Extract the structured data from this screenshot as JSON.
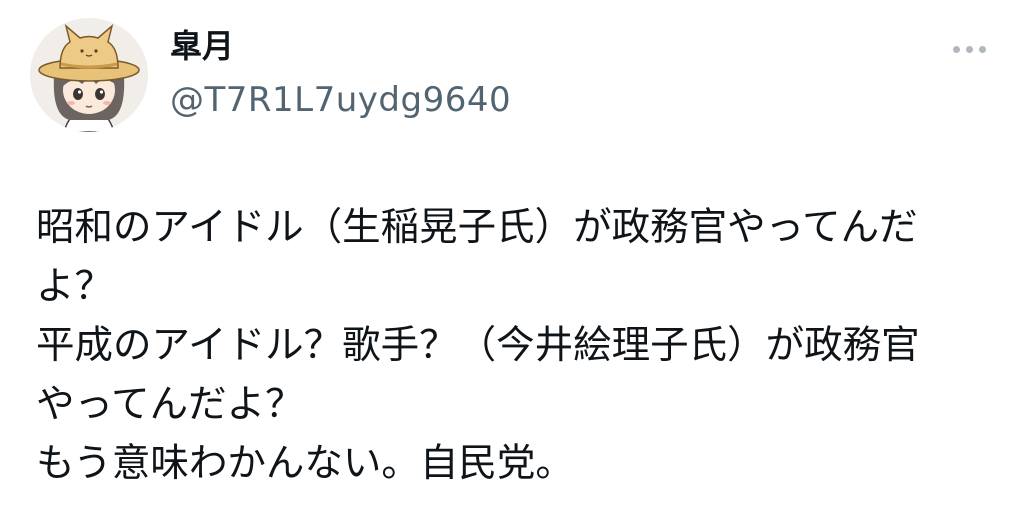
{
  "user": {
    "display_name": "皐月",
    "handle": "@T7R1L7uydg9640",
    "avatar_icon": "cat-ear-straw-hat-girl-avatar"
  },
  "actions": {
    "more_icon": "more-horizontal-icon"
  },
  "tweet": {
    "lines": [
      "昭和のアイドル（生稲晃子氏）が政務官やってんだ",
      "よ？",
      "平成のアイドル？歌手？（今井絵理子氏）が政務官",
      "やってんだよ？",
      "もう意味わかんない。自民党。"
    ]
  },
  "colors": {
    "text": "#0f1419",
    "secondary": "#536471",
    "hat": "#e9c27a",
    "hair": "#6b6460"
  }
}
